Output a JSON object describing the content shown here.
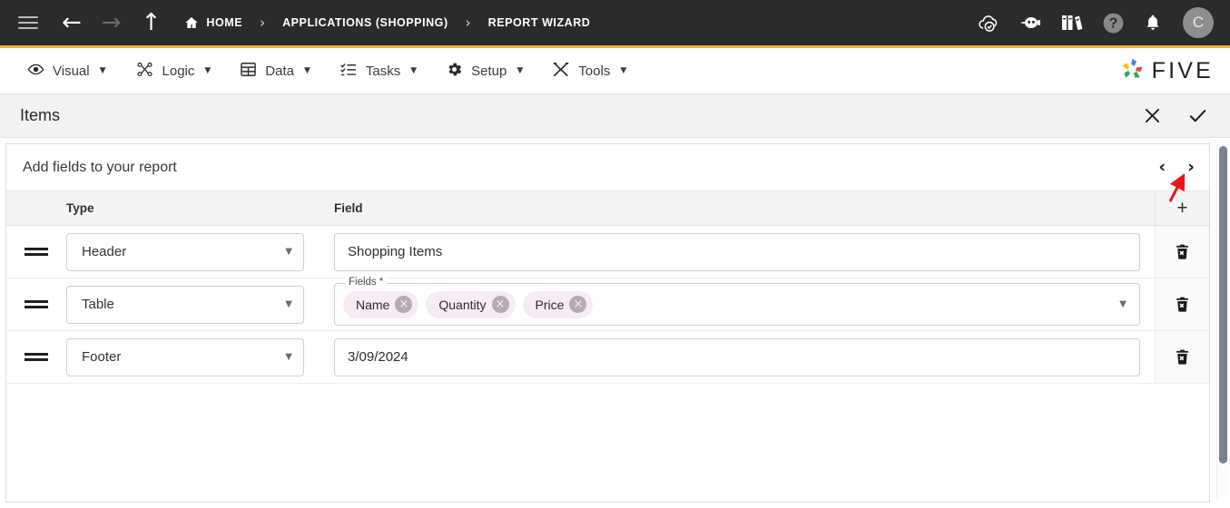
{
  "topbar": {
    "menu_icon": "hamburger-icon",
    "back_icon": "arrow-left-icon",
    "forward_icon": "arrow-right-icon",
    "up_icon": "arrow-up-icon",
    "breadcrumbs": [
      {
        "label": "HOME",
        "icon": "home-icon"
      },
      {
        "label": "APPLICATIONS (SHOPPING)",
        "icon": ""
      },
      {
        "label": "REPORT WIZARD",
        "icon": ""
      }
    ],
    "separator": "›",
    "right_icons": [
      {
        "name": "cloud-check-icon"
      },
      {
        "name": "chat-bot-icon"
      },
      {
        "name": "library-books-icon"
      },
      {
        "name": "help-icon"
      },
      {
        "name": "notifications-bell-icon"
      }
    ],
    "avatar_initial": "C",
    "accent_color": "#f0b323",
    "background_color": "#2b2b2b"
  },
  "menubar": {
    "items": [
      {
        "label": "Visual",
        "icon": "eye-icon",
        "caret": "▼"
      },
      {
        "label": "Logic",
        "icon": "logic-nodes-icon",
        "caret": "▼"
      },
      {
        "label": "Data",
        "icon": "table-grid-icon",
        "caret": "▼"
      },
      {
        "label": "Tasks",
        "icon": "checklist-icon",
        "caret": "▼"
      },
      {
        "label": "Setup",
        "icon": "gear-icon",
        "caret": "▼"
      },
      {
        "label": "Tools",
        "icon": "tools-icon",
        "caret": "▼"
      }
    ],
    "brand": {
      "text": "FIVE",
      "icon": "five-pinwheel-logo"
    }
  },
  "titlebar": {
    "title": "Items",
    "close_icon": "close-icon",
    "confirm_icon": "check-icon"
  },
  "panel": {
    "heading": "Add fields to your report",
    "prev_label": "‹",
    "next_label": "›",
    "add_row_label": "+",
    "columns": {
      "type": "Type",
      "field": "Field"
    },
    "rows": [
      {
        "handle": "drag-handle-icon",
        "type": "Header",
        "field_kind": "text",
        "field_value": "Shopping Items",
        "delete_icon": "delete-icon"
      },
      {
        "handle": "drag-handle-icon",
        "type": "Table",
        "field_kind": "chips",
        "field_legend": "Fields *",
        "chips": [
          "Name",
          "Quantity",
          "Price"
        ],
        "chip_remove_label": "×",
        "delete_icon": "delete-icon"
      },
      {
        "handle": "drag-handle-icon",
        "type": "Footer",
        "field_kind": "text",
        "field_value": "3/09/2024",
        "delete_icon": "delete-icon"
      }
    ],
    "dropdown_caret": "▼",
    "chip_color": "#f7ecf3"
  },
  "annotation": {
    "arrow_color": "#e8131a",
    "points_to": "next-page-chevron"
  }
}
